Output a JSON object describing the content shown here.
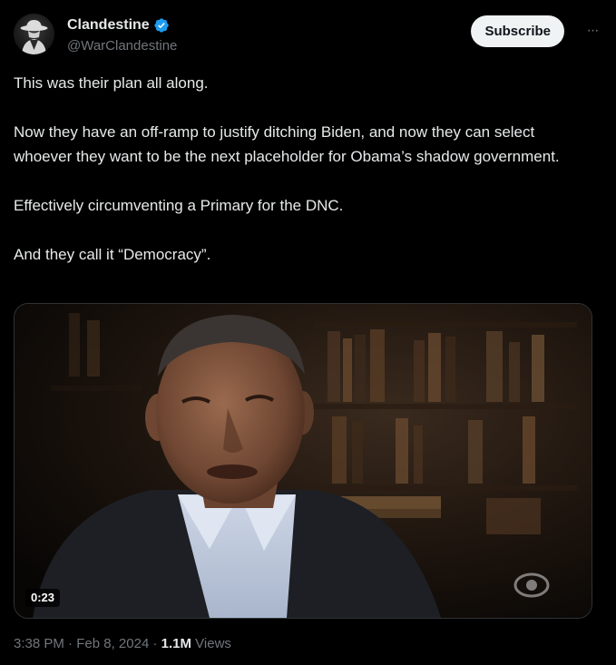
{
  "author": {
    "display_name": "Clandestine",
    "handle": "@WarClandestine",
    "verified_icon": "verified-badge-icon",
    "avatar_icon": "spy-silhouette-icon"
  },
  "actions": {
    "subscribe_label": "Subscribe",
    "more_icon": "more-options-icon",
    "more_glyph": "···"
  },
  "tweet": {
    "paragraphs": [
      "This was their plan all along.",
      "Now they have an off-ramp to justify ditching Biden, and now they can select whoever they want to be the next placeholder for Obama’s shadow government.",
      "Effectively circumventing a Primary for the DNC.",
      "And they call it “Democracy”."
    ]
  },
  "media": {
    "duration": "0:23",
    "content": "video-thumbnail"
  },
  "meta": {
    "time": "3:38 PM",
    "separator": "·",
    "date": "Feb 8, 2024",
    "views_count": "1.1M",
    "views_label": "Views"
  },
  "colors": {
    "background": "#000000",
    "text_primary": "#e7e9ea",
    "text_secondary": "#71767b",
    "verified": "#1d9bf0",
    "button_bg": "#eff3f4"
  }
}
